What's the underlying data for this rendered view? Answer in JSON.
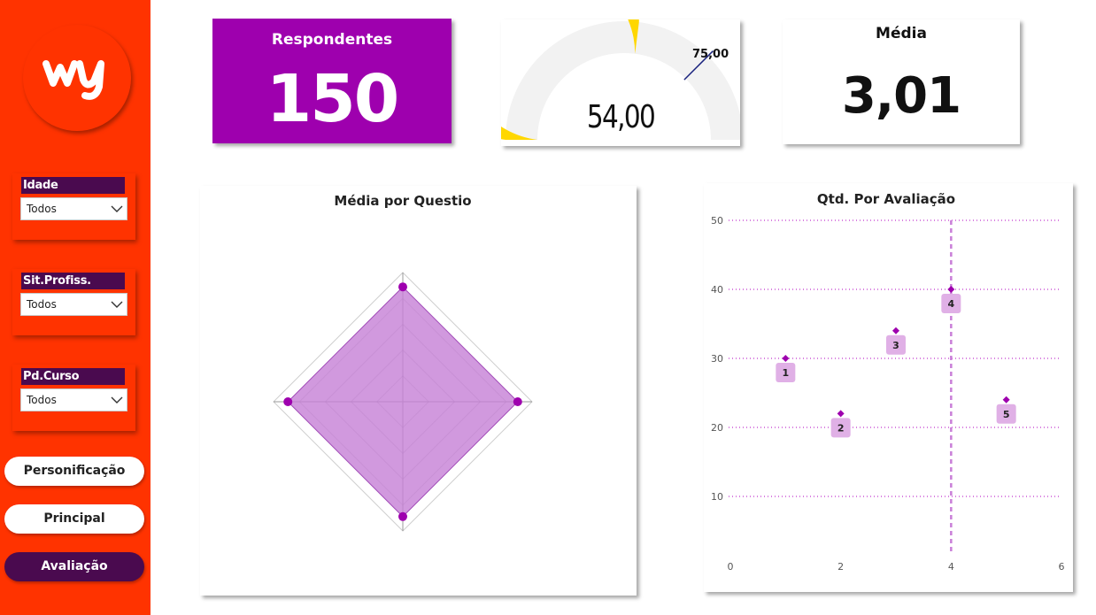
{
  "sidebar": {
    "logo_text": "wy",
    "filters": [
      {
        "label": "Idade",
        "value": "Todos"
      },
      {
        "label": "Sit.Profiss.",
        "value": "Todos"
      },
      {
        "label": "Pd.Curso",
        "value": "Todos"
      }
    ],
    "nav": [
      {
        "label": "Personificação",
        "active": false
      },
      {
        "label": "Principal",
        "active": false
      },
      {
        "label": "Avaliação",
        "active": true
      }
    ]
  },
  "kpis": {
    "respondentes": {
      "label": "Respondentes",
      "value": "150"
    },
    "gauge": {
      "value": "54,00",
      "target": "75,00",
      "min": 0,
      "max": 100,
      "value_num": 54,
      "target_num": 75
    },
    "media": {
      "label": "Média",
      "value": "3,01"
    }
  },
  "colors": {
    "sidebar_bg": "#ff3300",
    "dark_purple": "#4a0a4f",
    "kpi_purple": "#9e00ae",
    "gauge_fill": "#ffd700",
    "gauge_track": "#f2f2f2",
    "point_purple": "#9e00ae",
    "radar_fill": "#c57fd6"
  },
  "chart_data": [
    {
      "type": "radar",
      "title": "Média por Questio",
      "axes_count": 4,
      "max": 4.5,
      "values": [
        4.0,
        4.0,
        4.0,
        4.0
      ]
    },
    {
      "type": "scatter",
      "title": "Qtd. Por Avaliação",
      "xlim": [
        0,
        6
      ],
      "ylim": [
        0,
        50
      ],
      "x_ticks": [
        "0",
        "2",
        "4",
        "6"
      ],
      "y_ticks": [
        "10",
        "20",
        "30",
        "40",
        "50"
      ],
      "grid": true,
      "reference_x": 4,
      "points": [
        {
          "label": "1",
          "x": 1,
          "y": 30
        },
        {
          "label": "2",
          "x": 2,
          "y": 22
        },
        {
          "label": "3",
          "x": 3,
          "y": 34
        },
        {
          "label": "4",
          "x": 4,
          "y": 40
        },
        {
          "label": "5",
          "x": 5,
          "y": 24
        }
      ]
    }
  ]
}
